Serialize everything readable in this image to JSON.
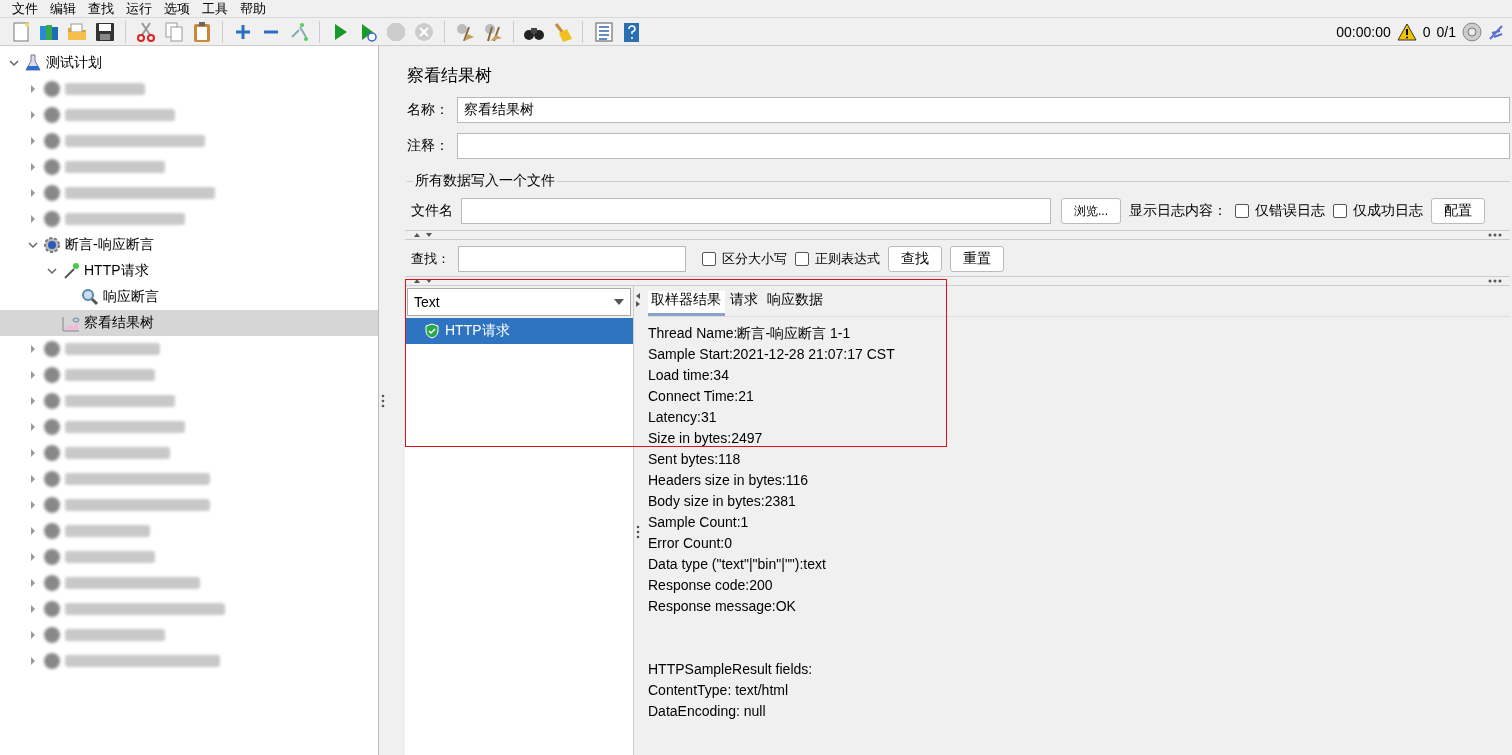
{
  "menu": [
    "文件",
    "编辑",
    "查找",
    "运行",
    "选项",
    "工具",
    "帮助"
  ],
  "status": {
    "timer": "00:00:00",
    "warnings": "0",
    "threads": "0/1"
  },
  "tree": {
    "label": "测试计划",
    "kind": "plan",
    "expanded": true,
    "selected": false,
    "blurred": false,
    "children": [
      {
        "kind": "group",
        "expanded": false,
        "selected": false,
        "blurred": true
      },
      {
        "kind": "group",
        "expanded": false,
        "selected": false,
        "blurred": true
      },
      {
        "kind": "group",
        "expanded": false,
        "selected": false,
        "blurred": true
      },
      {
        "kind": "group",
        "expanded": false,
        "selected": false,
        "blurred": true
      },
      {
        "kind": "group",
        "expanded": false,
        "selected": false,
        "blurred": true
      },
      {
        "kind": "group",
        "expanded": false,
        "selected": false,
        "blurred": true
      },
      {
        "label": "断言-响应断言",
        "kind": "gear",
        "expanded": true,
        "selected": false,
        "blurred": false,
        "children": [
          {
            "label": "HTTP请求",
            "kind": "sampler",
            "expanded": true,
            "selected": false,
            "blurred": false,
            "children": [
              {
                "label": "响应断言",
                "kind": "assertion",
                "selected": false,
                "blurred": false
              }
            ]
          },
          {
            "label": "察看结果树",
            "kind": "listener",
            "selected": true,
            "blurred": false
          }
        ]
      },
      {
        "kind": "group",
        "expanded": false,
        "selected": false,
        "blurred": true
      },
      {
        "kind": "group",
        "expanded": false,
        "selected": false,
        "blurred": true
      },
      {
        "kind": "group",
        "expanded": false,
        "selected": false,
        "blurred": true
      },
      {
        "kind": "group",
        "expanded": false,
        "selected": false,
        "blurred": true
      },
      {
        "kind": "group",
        "expanded": false,
        "selected": false,
        "blurred": true
      },
      {
        "kind": "group",
        "expanded": false,
        "selected": false,
        "blurred": true
      },
      {
        "kind": "group",
        "expanded": false,
        "selected": false,
        "blurred": true
      },
      {
        "kind": "group",
        "expanded": false,
        "selected": false,
        "blurred": true
      },
      {
        "kind": "group",
        "expanded": false,
        "selected": false,
        "blurred": true
      },
      {
        "kind": "group",
        "expanded": false,
        "selected": false,
        "blurred": true
      },
      {
        "kind": "group",
        "expanded": false,
        "selected": false,
        "blurred": true
      },
      {
        "kind": "group",
        "expanded": false,
        "selected": false,
        "blurred": true
      },
      {
        "kind": "group",
        "expanded": false,
        "selected": false,
        "blurred": true
      }
    ]
  },
  "panel": {
    "title": "察看结果树",
    "name_label": "名称：",
    "name_value": "察看结果树",
    "comment_label": "注释：",
    "file_section": "所有数据写入一个文件",
    "file_label": "文件名",
    "browse_button": "浏览...",
    "log_label": "显示日志内容：",
    "log_options": [
      {
        "label": "仅错误日志",
        "checked": false
      },
      {
        "label": "仅成功日志",
        "checked": false
      }
    ],
    "config_button": "配置",
    "search_label": "查找：",
    "search_options": [
      {
        "label": "区分大小写",
        "checked": false
      },
      {
        "label": "正则表达式",
        "checked": false
      }
    ],
    "search_buttons": [
      "查找",
      "重置"
    ]
  },
  "results": {
    "renderer": "Text",
    "samples": [
      {
        "label": "HTTP请求",
        "selected": true
      }
    ],
    "tabs": [
      {
        "label": "取样器结果",
        "selected": true
      },
      {
        "label": "请求",
        "selected": false
      },
      {
        "label": "响应数据",
        "selected": false
      }
    ],
    "blocks": [
      [
        "Thread Name:断言-响应断言 1-1",
        "Sample Start:2021-12-28 21:07:17 CST",
        "Load time:34",
        "Connect Time:21",
        "Latency:31",
        "Size in bytes:2497",
        "Sent bytes:118",
        "Headers size in bytes:116",
        "Body size in bytes:2381",
        "Sample Count:1",
        "Error Count:0",
        "Data type (\"text\"|\"bin\"|\"\"):text",
        "Response code:200",
        "Response message:OK"
      ],
      [
        "HTTPSampleResult fields:",
        "ContentType: text/html",
        "DataEncoding: null"
      ]
    ]
  }
}
